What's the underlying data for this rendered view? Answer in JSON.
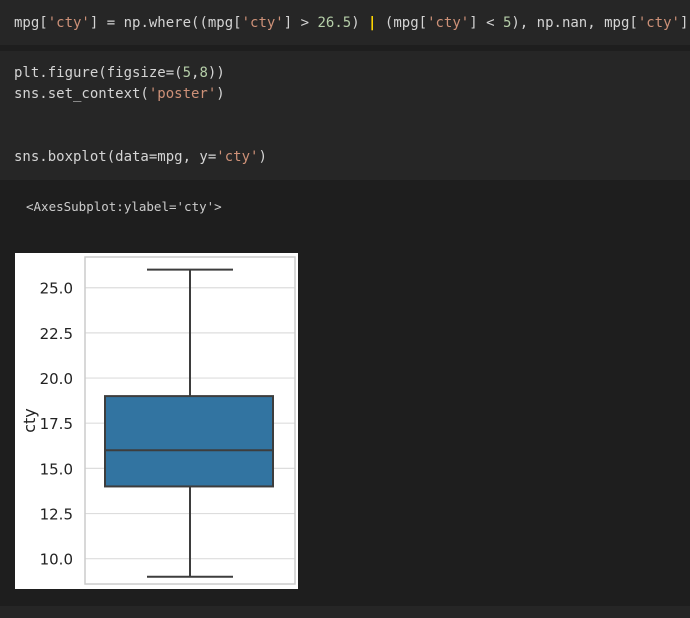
{
  "cells": [
    {
      "type": "code",
      "lines": [
        [
          {
            "t": "mpg[",
            "c": "op"
          },
          {
            "t": "'cty'",
            "c": "str"
          },
          {
            "t": "] = np.where((mpg[",
            "c": "op"
          },
          {
            "t": "'cty'",
            "c": "str"
          },
          {
            "t": "] > ",
            "c": "op"
          },
          {
            "t": "26.5",
            "c": "num"
          },
          {
            "t": ") ",
            "c": "op"
          },
          {
            "t": "|",
            "c": "pipe"
          },
          {
            "t": " (mpg[",
            "c": "op"
          },
          {
            "t": "'cty'",
            "c": "str"
          },
          {
            "t": "] < ",
            "c": "op"
          },
          {
            "t": "5",
            "c": "num"
          },
          {
            "t": "), np.nan, mpg[",
            "c": "op"
          },
          {
            "t": "'cty'",
            "c": "str"
          },
          {
            "t": "])",
            "c": "op"
          }
        ]
      ]
    },
    {
      "type": "code",
      "lines": [
        [
          {
            "t": "plt.figure(figsize=(",
            "c": "op"
          },
          {
            "t": "5",
            "c": "num"
          },
          {
            "t": ",",
            "c": "op"
          },
          {
            "t": "8",
            "c": "num"
          },
          {
            "t": "))",
            "c": "op"
          }
        ],
        [
          {
            "t": "sns.set_context(",
            "c": "op"
          },
          {
            "t": "'poster'",
            "c": "str"
          },
          {
            "t": ")",
            "c": "op"
          }
        ],
        [],
        [],
        [
          {
            "t": "sns.boxplot(data=mpg, y=",
            "c": "op"
          },
          {
            "t": "'cty'",
            "c": "str"
          },
          {
            "t": ")",
            "c": "op"
          }
        ]
      ]
    }
  ],
  "output": {
    "text": "<AxesSubplot:ylabel='cty'>"
  },
  "colors": {
    "background": "#1e1e1e",
    "cell_bg": "#262626",
    "string": "#ce9178",
    "number": "#b5cea8",
    "box_fill": "#3274a1",
    "box_edge": "#3d3d3d"
  },
  "chart_data": {
    "type": "box",
    "title": "",
    "xlabel": "",
    "ylabel": "cty",
    "ylim": [
      8.6,
      26.7
    ],
    "yticks": [
      10.0,
      12.5,
      15.0,
      17.5,
      20.0,
      22.5,
      25.0
    ],
    "ytick_labels": [
      "10.0",
      "12.5",
      "15.0",
      "17.5",
      "20.0",
      "22.5",
      "25.0"
    ],
    "grid": true,
    "series": [
      {
        "min": 9,
        "q1": 14,
        "median": 16,
        "q3": 19,
        "max": 26
      }
    ]
  }
}
